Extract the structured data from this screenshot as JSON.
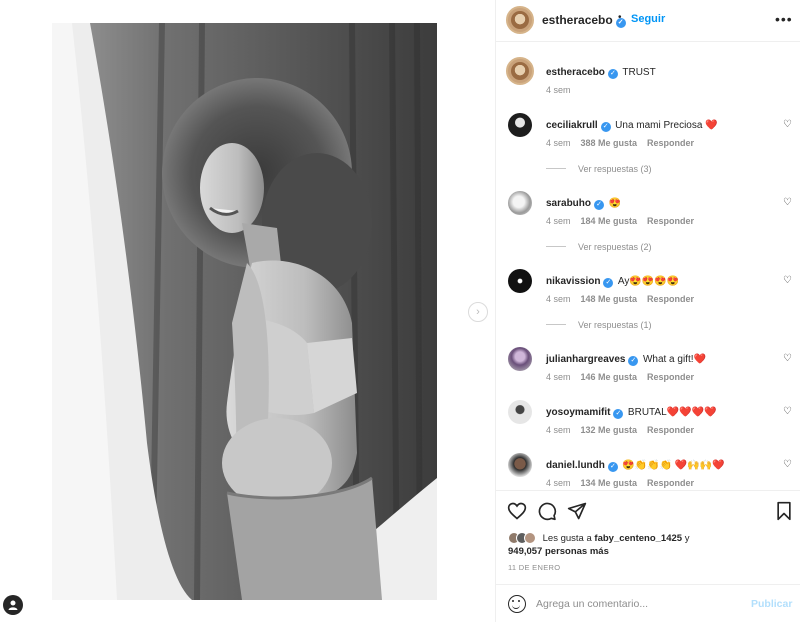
{
  "post": {
    "username": "estheracebo",
    "follow_label": "Seguir",
    "more_icon": "more-options-icon",
    "caption": {
      "username": "estheracebo",
      "text": "TRUST",
      "time": "4 sem"
    }
  },
  "comments": [
    {
      "user": "ceciliakrull",
      "text": "Una mami Preciosa ❤️",
      "time": "4 sem",
      "likes": "388 Me gusta",
      "reply": "Responder",
      "view_replies": "Ver respuestas (3)"
    },
    {
      "user": "sarabuho",
      "text": "😍",
      "time": "4 sem",
      "likes": "184 Me gusta",
      "reply": "Responder",
      "view_replies": "Ver respuestas (2)"
    },
    {
      "user": "nikavission",
      "text": "Ay😍😍😍😍",
      "time": "4 sem",
      "likes": "148 Me gusta",
      "reply": "Responder",
      "view_replies": "Ver respuestas (1)"
    },
    {
      "user": "julianhargreaves",
      "text": "What a gift!❤️",
      "time": "4 sem",
      "likes": "146 Me gusta",
      "reply": "Responder"
    },
    {
      "user": "yosoymamifit",
      "text": "BRUTAL❤️❤️❤️❤️",
      "time": "4 sem",
      "likes": "132 Me gusta",
      "reply": "Responder"
    },
    {
      "user": "daniel.lundh",
      "text": "😍👏👏👏 ❤️🙌🙌❤️",
      "time": "4 sem",
      "likes": "134 Me gusta",
      "reply": "Responder"
    }
  ],
  "likes": {
    "prefix": "Les gusta a",
    "first_user": "faby_centeno_1425",
    "connector": "y",
    "count": "949,057 personas más"
  },
  "date": "11 DE ENERO",
  "comment_box": {
    "placeholder": "Agrega un comentario...",
    "publish_label": "Publicar"
  },
  "colors": {
    "accent": "#0095f6",
    "verified": "#3897f0",
    "publish_disabled": "#b2dffc",
    "muted": "#8e8e8e"
  }
}
